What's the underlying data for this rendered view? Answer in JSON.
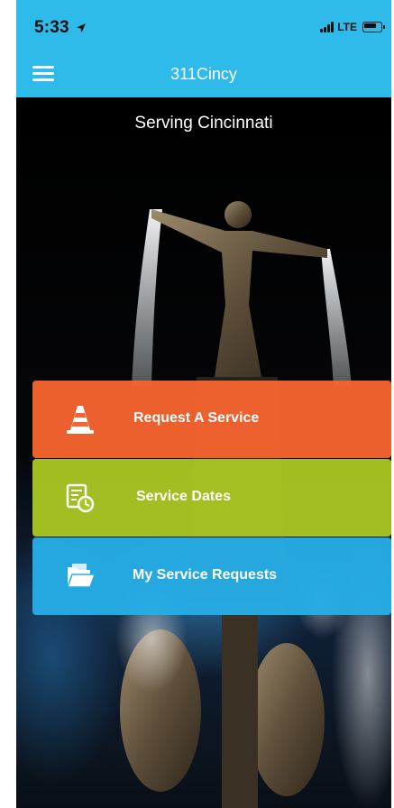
{
  "status_bar": {
    "time": "5:33",
    "network": "LTE"
  },
  "header": {
    "title": "311Cincy"
  },
  "hero": {
    "subtitle": "Serving Cincinnati"
  },
  "actions": [
    {
      "label": "Request A Service",
      "icon": "traffic-cone-icon",
      "color": "#f66430"
    },
    {
      "label": "Service Dates",
      "icon": "calendar-clock-icon",
      "color": "#aac823"
    },
    {
      "label": "My Service Requests",
      "icon": "folder-icon",
      "color": "#27ade6"
    }
  ],
  "colors": {
    "brand": "#2fbbe9"
  }
}
